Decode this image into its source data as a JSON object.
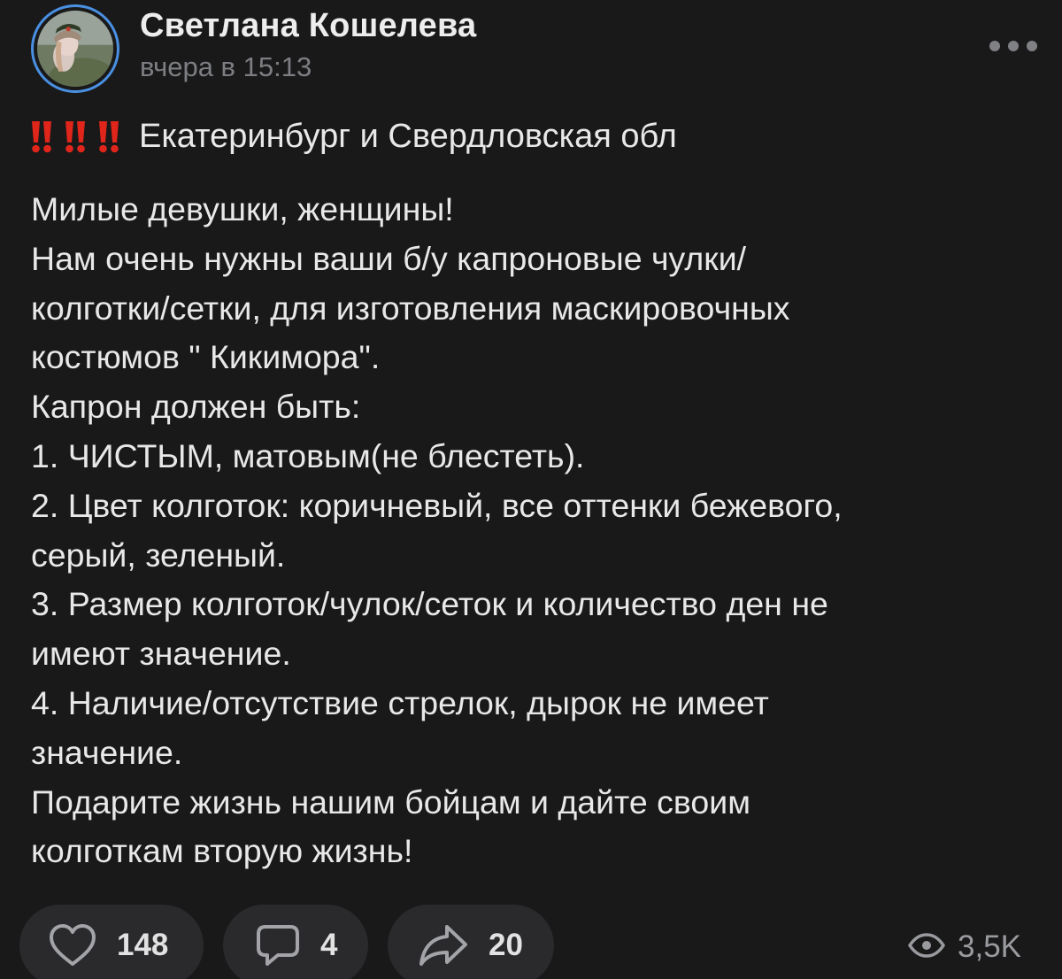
{
  "author": {
    "name": "Светлана Кошелева",
    "time": "вчера в 15:13"
  },
  "header": {
    "more_icon": "more-horizontal-icon"
  },
  "post": {
    "headline": "Екатеринбург и Свердловская обл",
    "headline_emoji": "double-exclamation-icon x3",
    "lines": [
      "Милые девушки, женщины!",
      "Нам очень нужны ваши б/у капроновые чулки/",
      "колготки/сетки, для изготовления маскировочных",
      "костюмов \" Кикимора\".",
      "Капрон должен быть:",
      "1. ЧИСТЫМ, матовым(не блестеть).",
      "2. Цвет колготок: коричневый, все оттенки бежевого,",
      "серый, зеленый.",
      "3. Размер колготок/чулок/сеток и количество ден не",
      "имеют значение.",
      "4. Наличие/отсутствие стрелок, дырок не имеет",
      "значение.",
      "Подарите жизнь нашим бойцам и дайте своим",
      "колготкам вторую жизнь!"
    ]
  },
  "actions": {
    "likes": "148",
    "comments": "4",
    "shares": "20",
    "views": "3,5K"
  },
  "colors": {
    "background": "#19191a",
    "text": "#e8e8e9",
    "muted": "#7d7e82",
    "pill": "#2a2a2c",
    "avatar_ring": "#4a90e2",
    "emoji_red": "#e0251b"
  }
}
